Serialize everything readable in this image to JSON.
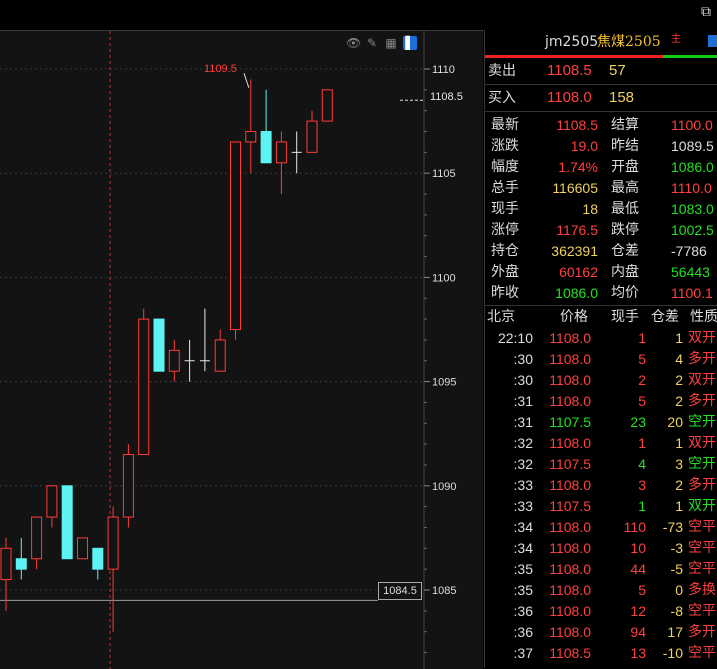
{
  "window": {
    "restore_glyph": "⧉"
  },
  "toolbar_icons": [
    "eye-icon",
    "pencil-icon",
    "grid-icon",
    "panel-icon"
  ],
  "chart": {
    "peak_label": "1109.5",
    "current_price_label": "1108.5",
    "crosshair_price_label": "1084.5",
    "colors": {
      "up": "#ff3b3b",
      "down": "#5df3f3",
      "neutral": "#e8e8e8",
      "grid": "#3a3a3a"
    }
  },
  "chart_data": {
    "type": "candlestick",
    "y_ticks": [
      "1110",
      "1105",
      "1100",
      "1095",
      "1090",
      "1085"
    ],
    "ylim": [
      1082,
      1112
    ],
    "candles": [
      {
        "o": 1085.5,
        "h": 1087.5,
        "l": 1084.0,
        "c": 1087.0
      },
      {
        "o": 1086.5,
        "h": 1087.5,
        "l": 1085.5,
        "c": 1086.0
      },
      {
        "o": 1086.5,
        "h": 1088.5,
        "l": 1086.0,
        "c": 1088.5
      },
      {
        "o": 1088.5,
        "h": 1090.0,
        "l": 1088.0,
        "c": 1090.0
      },
      {
        "o": 1090.0,
        "h": 1090.0,
        "l": 1086.5,
        "c": 1086.5
      },
      {
        "o": 1086.5,
        "h": 1087.5,
        "l": 1086.5,
        "c": 1087.5
      },
      {
        "o": 1087.0,
        "h": 1087.0,
        "l": 1085.5,
        "c": 1086.0
      },
      {
        "o": 1086.0,
        "h": 1089.0,
        "l": 1083.0,
        "c": 1088.5
      },
      {
        "o": 1088.5,
        "h": 1092.0,
        "l": 1088.0,
        "c": 1091.5
      },
      {
        "o": 1091.5,
        "h": 1098.5,
        "l": 1091.5,
        "c": 1098.0
      },
      {
        "o": 1098.0,
        "h": 1098.0,
        "l": 1095.5,
        "c": 1095.5
      },
      {
        "o": 1095.5,
        "h": 1097.0,
        "l": 1095.0,
        "c": 1096.5
      },
      {
        "o": 1096.0,
        "h": 1097.0,
        "l": 1095.0,
        "c": 1096.0
      },
      {
        "o": 1096.0,
        "h": 1098.5,
        "l": 1095.5,
        "c": 1096.0
      },
      {
        "o": 1095.5,
        "h": 1097.5,
        "l": 1095.5,
        "c": 1097.0
      },
      {
        "o": 1097.5,
        "h": 1104.0,
        "l": 1097.0,
        "c": 1106.5
      },
      {
        "o": 1106.5,
        "h": 1109.5,
        "l": 1105.0,
        "c": 1107.0
      },
      {
        "o": 1107.0,
        "h": 1109.0,
        "l": 1105.5,
        "c": 1105.5
      },
      {
        "o": 1105.5,
        "h": 1107.0,
        "l": 1104.0,
        "c": 1106.5
      },
      {
        "o": 1106.0,
        "h": 1107.0,
        "l": 1105.0,
        "c": 1106.0
      },
      {
        "o": 1106.0,
        "h": 1108.0,
        "l": 1106.0,
        "c": 1107.5
      },
      {
        "o": 1107.5,
        "h": 1109.0,
        "l": 1107.5,
        "c": 1109.0
      }
    ]
  },
  "quote": {
    "code": "jm2505",
    "name": "焦煤2505",
    "main_tag": "主",
    "ask": {
      "label": "卖出",
      "price": "1108.5",
      "volume": "57"
    },
    "bid": {
      "label": "买入",
      "price": "1108.0",
      "volume": "158"
    },
    "stats": [
      {
        "l1": "最新",
        "v1": "1108.5",
        "c1": "red",
        "l2": "结算",
        "v2": "1100.0",
        "c2": "red"
      },
      {
        "l1": "涨跌",
        "v1": "19.0",
        "c1": "red",
        "l2": "昨结",
        "v2": "1089.5",
        "c2": "white"
      },
      {
        "l1": "幅度",
        "v1": "1.74%",
        "c1": "red",
        "l2": "开盘",
        "v2": "1086.0",
        "c2": "green"
      },
      {
        "l1": "总手",
        "v1": "116605",
        "c1": "yellow",
        "l2": "最高",
        "v2": "1110.0",
        "c2": "red"
      },
      {
        "l1": "现手",
        "v1": "18",
        "c1": "yellow",
        "l2": "最低",
        "v2": "1083.0",
        "c2": "green"
      },
      {
        "l1": "涨停",
        "v1": "1176.5",
        "c1": "red",
        "l2": "跌停",
        "v2": "1002.5",
        "c2": "green"
      },
      {
        "l1": "持仓",
        "v1": "362391",
        "c1": "yellow",
        "l2": "仓差",
        "v2": "-7786",
        "c2": "white"
      },
      {
        "l1": "外盘",
        "v1": "60162",
        "c1": "red",
        "l2": "内盘",
        "v2": "56443",
        "c2": "green"
      },
      {
        "l1": "昨收",
        "v1": "1086.0",
        "c1": "green",
        "l2": "均价",
        "v2": "1100.1",
        "c2": "red"
      }
    ],
    "tick_headers": {
      "time": "北京",
      "price": "价格",
      "vol": "现手",
      "oi": "仓差",
      "kind": "性质"
    },
    "ticks": [
      {
        "t": "22:10",
        "p": "1108.0",
        "pc": "red",
        "v": "1",
        "vc": "red",
        "d": "1",
        "k": "双开",
        "kc": "red"
      },
      {
        "t": ":30",
        "p": "1108.0",
        "pc": "red",
        "v": "5",
        "vc": "red",
        "d": "4",
        "k": "多开",
        "kc": "red"
      },
      {
        "t": ":30",
        "p": "1108.0",
        "pc": "red",
        "v": "2",
        "vc": "red",
        "d": "2",
        "k": "双开",
        "kc": "red"
      },
      {
        "t": ":31",
        "p": "1108.0",
        "pc": "red",
        "v": "5",
        "vc": "red",
        "d": "2",
        "k": "多开",
        "kc": "red"
      },
      {
        "t": ":31",
        "p": "1107.5",
        "pc": "green",
        "v": "23",
        "vc": "green",
        "d": "20",
        "k": "空开",
        "kc": "green"
      },
      {
        "t": ":32",
        "p": "1108.0",
        "pc": "red",
        "v": "1",
        "vc": "red",
        "d": "1",
        "k": "双开",
        "kc": "red"
      },
      {
        "t": ":32",
        "p": "1107.5",
        "pc": "red",
        "v": "4",
        "vc": "green",
        "d": "3",
        "k": "空开",
        "kc": "green"
      },
      {
        "t": ":33",
        "p": "1108.0",
        "pc": "red",
        "v": "3",
        "vc": "red",
        "d": "2",
        "k": "多开",
        "kc": "red"
      },
      {
        "t": ":33",
        "p": "1107.5",
        "pc": "red",
        "v": "1",
        "vc": "green",
        "d": "1",
        "k": "双开",
        "kc": "green"
      },
      {
        "t": ":34",
        "p": "1108.0",
        "pc": "red",
        "v": "110",
        "vc": "red",
        "d": "-73",
        "k": "空平",
        "kc": "red"
      },
      {
        "t": ":34",
        "p": "1108.0",
        "pc": "red",
        "v": "10",
        "vc": "red",
        "d": "-3",
        "k": "空平",
        "kc": "red"
      },
      {
        "t": ":35",
        "p": "1108.0",
        "pc": "red",
        "v": "44",
        "vc": "red",
        "d": "-5",
        "k": "空平",
        "kc": "red"
      },
      {
        "t": ":35",
        "p": "1108.0",
        "pc": "red",
        "v": "5",
        "vc": "red",
        "d": "0",
        "k": "多换",
        "kc": "red"
      },
      {
        "t": ":36",
        "p": "1108.0",
        "pc": "red",
        "v": "12",
        "vc": "red",
        "d": "-8",
        "k": "空平",
        "kc": "red"
      },
      {
        "t": ":36",
        "p": "1108.0",
        "pc": "red",
        "v": "94",
        "vc": "red",
        "d": "17",
        "k": "多开",
        "kc": "red"
      },
      {
        "t": ":37",
        "p": "1108.5",
        "pc": "red",
        "v": "13",
        "vc": "red",
        "d": "-10",
        "k": "空平",
        "kc": "red"
      }
    ]
  }
}
